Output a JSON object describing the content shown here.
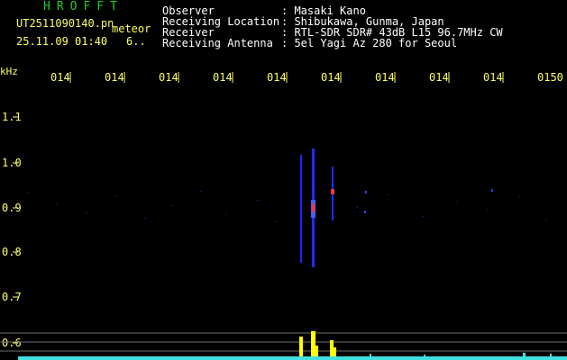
{
  "header": {
    "brand": "HROFFT",
    "file_name": "UT2511090140.pn",
    "meteor_label": "meteor",
    "datetime": "25.11.09 01:40",
    "meteor_count": "6..",
    "info_labels": [
      "Observer",
      "Receiving Location",
      "Receiver",
      "Receiving Antenna"
    ],
    "info_values": [
      ": Masaki Kano",
      ": Shibukawa, Gunma, Japan",
      ": RTL-SDR SDR# 43dB L15 96.7MHz CW",
      ": 5el Yagi Az 280 for Seoul"
    ]
  },
  "axis": {
    "y_unit": "kHz",
    "y_ticks": [
      "1.1",
      "1.0",
      "0.9",
      "0.8",
      "0.7",
      "0.6"
    ],
    "x_ticks": [
      "014",
      "014",
      "014",
      "014",
      "014",
      "014",
      "014",
      "014",
      "014",
      "0150"
    ]
  },
  "colors": {
    "background": "#000000",
    "tick_text": "#ffff66",
    "header_text": "#ffffff",
    "brand": "#20d020",
    "echo_blue": "#1a2cff",
    "echo_red": "#ff3344",
    "histogram_yellow": "#ffff00",
    "histogram_cyan": "#40e0e0"
  }
}
